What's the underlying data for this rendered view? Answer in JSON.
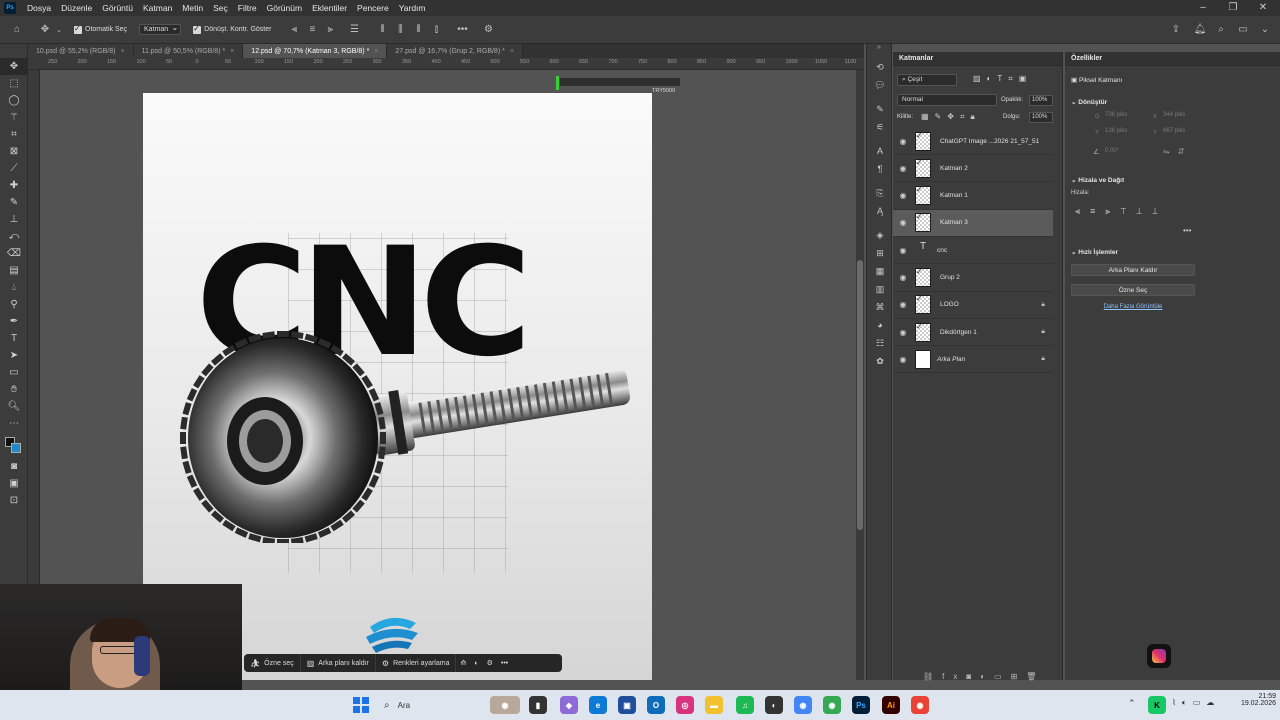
{
  "menu": {
    "app_icon": "Ps",
    "items": [
      "Dosya",
      "Düzenle",
      "Görüntü",
      "Katman",
      "Metin",
      "Seç",
      "Filtre",
      "Görünüm",
      "Eklentiler",
      "Pencere",
      "Yardım"
    ]
  },
  "options": {
    "auto_select_label": "Otomatik Seç",
    "auto_select_target": "Katman",
    "transform_controls_label": "Dönüşt. Kontr. Göster"
  },
  "tabs": [
    {
      "label": "10.psd @ 55,2% (RGB/8)",
      "close": "×"
    },
    {
      "label": "11.psd @ 50,5% (RGB/8) *",
      "close": "×"
    },
    {
      "label": "12.psd @ 70,7% (Katman 3, RGB/8) *",
      "close": "×"
    },
    {
      "label": "27.psd @ 16,7% (Grup 2, RGB/8) *",
      "close": "×"
    }
  ],
  "ruler_top": [
    "250",
    "200",
    "150",
    "100",
    "50",
    "0",
    "50",
    "100",
    "150",
    "200",
    "250",
    "300",
    "350",
    "400",
    "450",
    "500",
    "550",
    "600",
    "650",
    "700",
    "750",
    "800",
    "850",
    "900",
    "950",
    "1000",
    "1050",
    "1100"
  ],
  "canvas": {
    "headline": "CNC",
    "measure_label": "TRY5000"
  },
  "context_bar": {
    "select_subject": "Özne seç",
    "remove_background": "Arka planı kaldır",
    "adjust_colors": "Renkleri ayarlama"
  },
  "layers_panel": {
    "title": "Katmanlar",
    "filter_label": "Çeşit",
    "blend_mode": "Normal",
    "opacity_label": "Opaklık:",
    "opacity_value": "100%",
    "lock_label": "Kilitle:",
    "fill_label": "Dolgu:",
    "fill_value": "100%",
    "layers": [
      {
        "name": "ChatGPT Image ...2026 21_57_51",
        "type": "image",
        "locked": false,
        "selected": false,
        "italic": false
      },
      {
        "name": "Katman 2",
        "type": "empty",
        "locked": false,
        "selected": false,
        "italic": false
      },
      {
        "name": "Katman 1",
        "type": "empty",
        "locked": false,
        "selected": false,
        "italic": false
      },
      {
        "name": "Katman 3",
        "type": "empty",
        "locked": false,
        "selected": true,
        "italic": false
      },
      {
        "name": "cnc",
        "type": "text",
        "locked": false,
        "selected": false,
        "italic": false
      },
      {
        "name": "Grup 2",
        "type": "empty",
        "locked": false,
        "selected": false,
        "italic": false
      },
      {
        "name": "LOGO",
        "type": "smart",
        "locked": true,
        "selected": false,
        "italic": false
      },
      {
        "name": "Dikdörtgen 1",
        "type": "smart",
        "locked": true,
        "selected": false,
        "italic": false
      },
      {
        "name": "Arka Plan",
        "type": "white",
        "locked": true,
        "selected": false,
        "italic": true
      }
    ]
  },
  "properties_panel": {
    "title": "Özellikler",
    "kind": "Piksel Katmanı",
    "transform_header": "Dönüştür",
    "w_label": "G",
    "w_value": "736 piks",
    "x_label": "X",
    "x_value": "344 piks",
    "h_label": "Y",
    "h_value": "136 piks",
    "y_label": "Y",
    "y_value": "667 piks",
    "angle_value": "0,00°",
    "align_header": "Hizala ve Dağıt",
    "align_label": "Hizala:",
    "quick_actions_header": "Hızlı İşlemler",
    "remove_bg_button": "Arka Planı Kaldır",
    "select_subject_button": "Özne Seç",
    "more_link": "Daha Fazla Görüntüle"
  },
  "taskbar": {
    "search_placeholder": "Ara",
    "time": "21:59",
    "date": "19.02.2026"
  },
  "colors": {
    "ui_dark": "#323232",
    "panel": "#3c3c3c",
    "workspace": "#535353",
    "accent": "#31a8ff"
  }
}
